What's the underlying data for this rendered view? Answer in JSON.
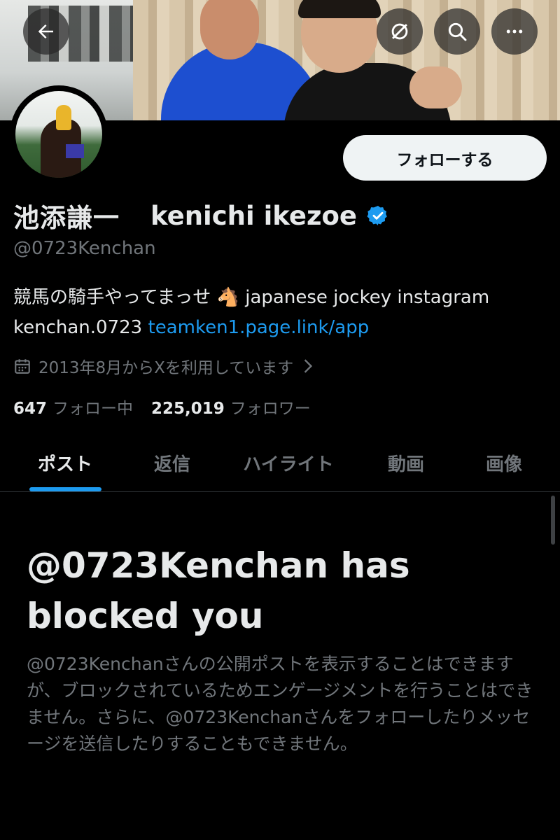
{
  "colors": {
    "background": "#000000",
    "accent": "#1d9bf0",
    "text_primary": "#e7e9ea",
    "text_secondary": "#71767b",
    "follow_bg": "#eff3f4"
  },
  "header": {
    "back_icon": "arrow-left-icon",
    "grok_icon": "grok-icon",
    "search_icon": "search-icon",
    "more_icon": "more-horizontal-icon"
  },
  "profile": {
    "follow_label": "フォローする",
    "display_name_jp": "池添謙一",
    "display_name_en": "kenichi ikezoe",
    "handle": "@0723Kenchan",
    "bio_text": "競馬の騎手やってまっせ 🐴 japanese jockey instagram kenchan.0723 ",
    "bio_link": "teamken1.page.link/app",
    "joined": "2013年8月からXを利用しています",
    "following_count": "647",
    "following_label": "フォロー中",
    "followers_count": "225,019",
    "followers_label": "フォロワー"
  },
  "tabs": [
    {
      "label": "ポスト",
      "active": true
    },
    {
      "label": "返信",
      "active": false
    },
    {
      "label": "ハイライト",
      "active": false
    },
    {
      "label": "動画",
      "active": false
    },
    {
      "label": "画像",
      "active": false
    }
  ],
  "blocked": {
    "title": "@0723Kenchan has blocked you",
    "description": "@0723Kenchanさんの公開ポストを表示することはできますが、ブロックされているためエンゲージメントを行うことはできません。さらに、@0723Kenchanさんをフォローしたりメッセージを送信したりすることもできません。"
  }
}
